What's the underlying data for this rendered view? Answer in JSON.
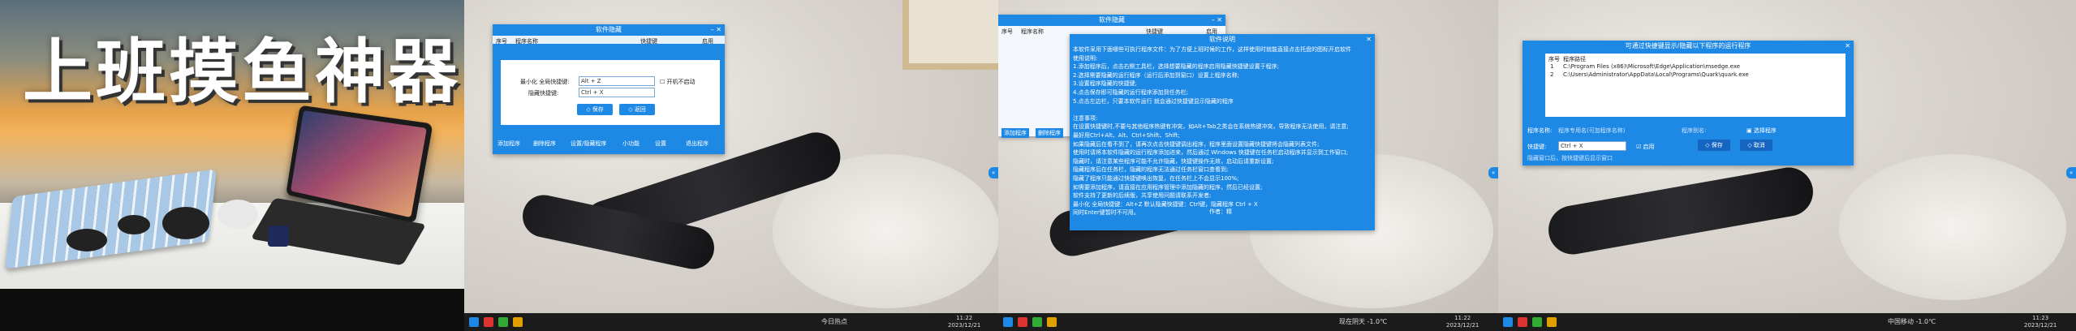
{
  "cover": {
    "title": "上班摸鱼神器"
  },
  "panel2": {
    "window_title": "软件隐藏",
    "columns": [
      "序号",
      "程序名称",
      "快捷键",
      "启用"
    ],
    "dialog": {
      "label_show": "最小化 全局快捷键:",
      "label_hide": "隐藏快捷键:",
      "value_show": "Alt + Z",
      "value_hide": "Ctrl + X",
      "autostart": "开机不启动",
      "save": "保存",
      "back": "返回"
    },
    "toolbar": [
      "添加程序",
      "删除程序",
      "设置/隐藏程序",
      "小功能",
      "设置",
      "退出程序"
    ],
    "taskbar": {
      "weather": "今日热点",
      "time": "11:22",
      "date": "2023/12/21"
    }
  },
  "panel3": {
    "window_title": "软件隐藏",
    "columns": [
      "序号",
      "程序名称",
      "快捷键",
      "启用"
    ],
    "help_title": "软件说明",
    "help_lines": [
      "本软件采用下面哪些可执行程序文件：为了方便上班时候的工作，这样使用时就能直接点击托盘的图标开启软件",
      "使用说明:",
      "1.添加程序后，点击右侧工具栏，选择想要隐藏的程序启用隐藏快捷键设置于程序;",
      "2.选择需要隐藏的运行程序（运行后添加到窗口）设置上程序名称;",
      "3.设置程序隐藏的快捷键;",
      "4.点击保存即可隐藏的运行程序添加到任务栏;",
      "5.点击左边栏，只要本软件运行 就会通过快捷键显示隐藏的程序",
      "",
      "注意事项:",
      "在设置快捷键时,不要与其他程序热键有冲突，如Alt+Tab之类会在系统热键冲突，导致程序无法使用，请注意;",
      "最好用Ctrl+Alt、Alt、Ctrl+Shift、Shift;",
      "如果隐藏后在看不到了，请再次点击快捷键调出程序，程序里面设置隐藏快捷键将会隐藏列表文件;",
      "使用时请将本软件隐藏的运行程序添加进来，然后通过 Windows 快捷键在任务栏启动程序并显示到工作窗口;",
      "隐藏时，请注意某些程序可能不允许隐藏，快捷键操作无效，启动后请重新设置;",
      "隐藏程序后在任务栏，隐藏的程序无法通过任务栏窗口查看到;",
      "隐藏了程序只能通过快捷键唤出恢复，在任务栏上不会显示100%;",
      "如需要添加程序，请直接在应用程序管理中添加隐藏的程序，然后已经设置;",
      "软件支持了更新的后续版，共享使用问题请联系开发者;",
      "最小化 全局快捷键：Alt+Z 默认隐藏快捷键：Ctrl键，隐藏程序 Ctrl + X",
      "同时Enter键暂时不可用。"
    ],
    "author": "作者：精",
    "taskbar": {
      "weather": "现在阴天 -1.0℃",
      "time": "11:22",
      "date": "2023/12/21"
    }
  },
  "panel4": {
    "window_title": "可通过快捷键显示/隐藏以下程序的运行程序",
    "columns": [
      "序号",
      "程序路径"
    ],
    "rows": [
      {
        "id": "1",
        "path": "C:\\Program Files (x86)\\Microsoft\\Edge\\Application\\msedge.exe"
      },
      {
        "id": "2",
        "path": "C:\\Users\\Administrator\\AppData\\Local\\Programs\\Quark\\quark.exe"
      }
    ],
    "label_name": "程序名称:",
    "name_value": "程序专用名(可加程序名称)",
    "label_alias": "程序别名:",
    "select_btn": "选择程序",
    "label_hotkey": "快捷键:",
    "hotkey_value": "Ctrl + X",
    "enable": "启用",
    "save": "保存",
    "cancel": "取消",
    "hint": "隐藏窗口后，按快捷键后显示窗口",
    "taskbar": {
      "weather": "中国移动 -1.0℃",
      "time": "11:23",
      "date": "2023/12/21"
    }
  }
}
